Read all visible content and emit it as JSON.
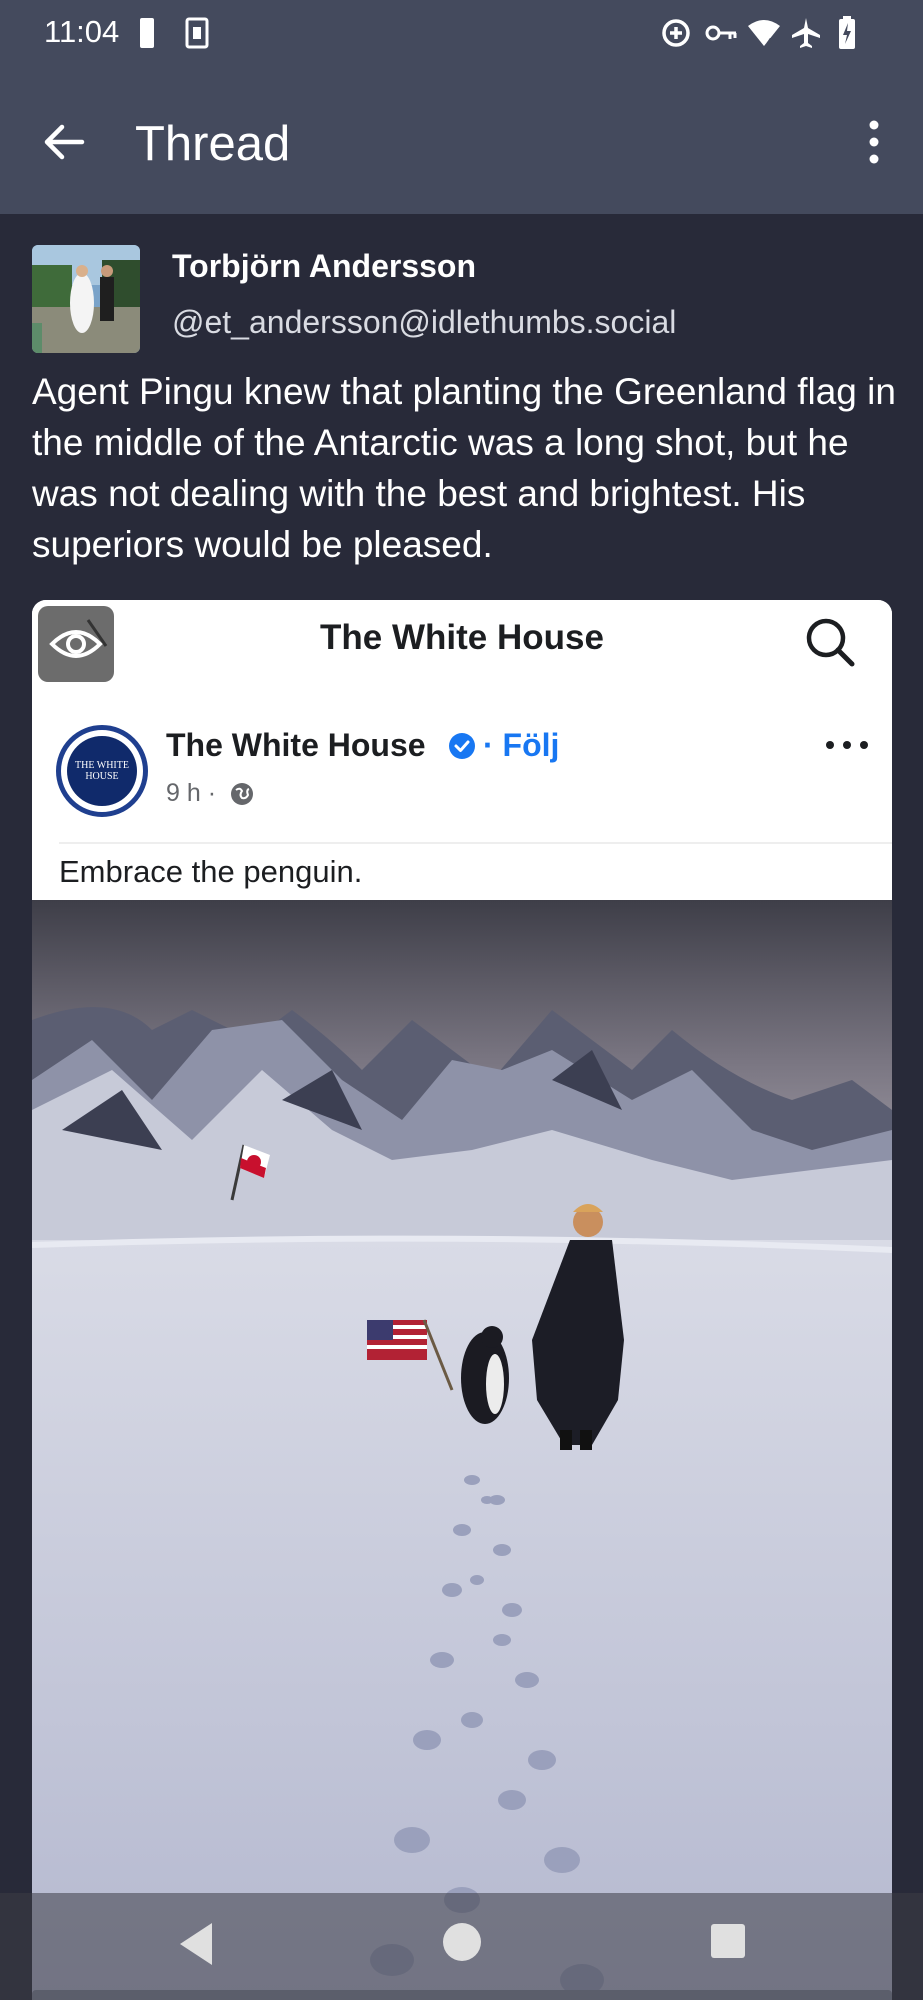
{
  "status_bar": {
    "time": "11:04",
    "icons": [
      "battery-saver-icon",
      "sim-icon",
      "data-saver-icon",
      "vpn-key-icon",
      "wifi-4-icon",
      "airplane-icon",
      "battery-charging-icon"
    ]
  },
  "app_bar": {
    "title": "Thread",
    "back_icon": "arrow-left-icon",
    "menu_icon": "more-vert-icon"
  },
  "post": {
    "author_name": "Torbjörn Andersson",
    "author_handle": "@et_andersson@idlethumbs.social",
    "text": "Agent Pingu knew that planting the Greenland flag in the middle of the Antarctic was a long shot, but he was not dealing with the best and brightest. His superiors would be pleased."
  },
  "media": {
    "sensitive_toggle_icon": "eye-off-icon",
    "header_title": "The White House",
    "account_name": "The White House",
    "follow_label": "· Följ",
    "time": "9 h ·",
    "avatar_text": "THE WHITE HOUSE",
    "caption": "Embrace the penguin.",
    "colors": {
      "follow": "#1877f2",
      "badge": "#1877f2"
    }
  },
  "nav_bar": {
    "icons": [
      "back-triangle-icon",
      "home-circle-icon",
      "recents-square-icon"
    ]
  }
}
